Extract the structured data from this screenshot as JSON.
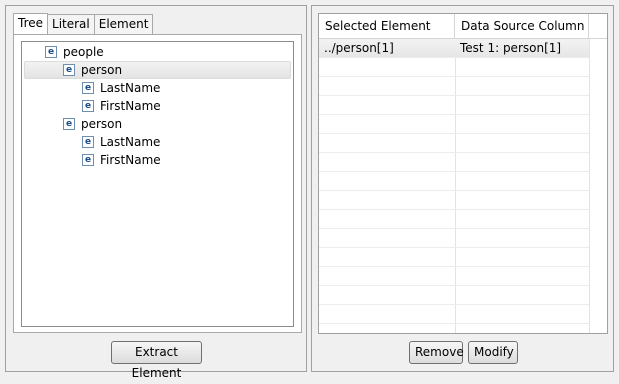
{
  "left_panel": {
    "tabs": [
      {
        "label": "Tree",
        "active": true
      },
      {
        "label": "Literal",
        "active": false
      },
      {
        "label": "Element",
        "active": false
      }
    ],
    "tree": [
      {
        "label": "people",
        "icon": "element-icon",
        "level": 0,
        "selected": false
      },
      {
        "label": "person",
        "icon": "element-icon",
        "level": 1,
        "selected": true
      },
      {
        "label": "LastName",
        "icon": "element-icon",
        "level": 2,
        "selected": false
      },
      {
        "label": "FirstName",
        "icon": "element-icon",
        "level": 2,
        "selected": false
      },
      {
        "label": "person",
        "icon": "element-icon",
        "level": 1,
        "selected": false
      },
      {
        "label": "LastName",
        "icon": "element-icon",
        "level": 2,
        "selected": false
      },
      {
        "label": "FirstName",
        "icon": "element-icon",
        "level": 2,
        "selected": false
      }
    ],
    "icon_glyph": "e",
    "extract_button_label": "Extract Element"
  },
  "right_panel": {
    "columns": [
      "Selected Element",
      "Data Source Column",
      ""
    ],
    "rows": [
      {
        "selected_element": "../person[1]",
        "data_source_column": "Test 1: person[1]"
      }
    ],
    "remove_button_label": "Remove",
    "modify_button_label": "Modify"
  },
  "colors": {
    "window_bg": "#f0f0f0",
    "icon_text": "#1f4f8a",
    "icon_border": "#6f8fb0"
  }
}
